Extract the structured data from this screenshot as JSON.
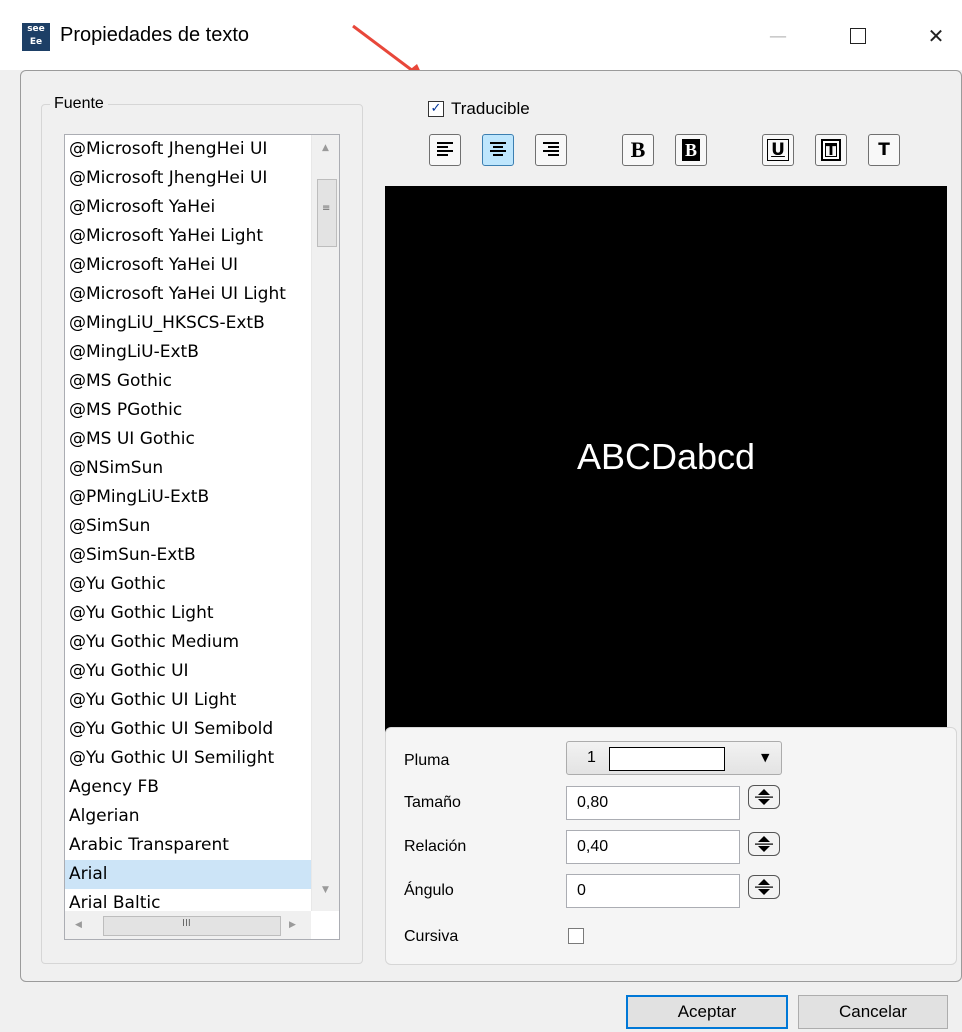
{
  "window": {
    "title": "Propiedades de texto",
    "icon_text": "see Ee",
    "minimize_glyph": "—",
    "maximize_glyph": "☐",
    "close_glyph": "✕"
  },
  "font_group": {
    "label": "Fuente",
    "fonts": [
      "@Microsoft JhengHei UI",
      "@Microsoft JhengHei UI",
      "@Microsoft YaHei",
      "@Microsoft YaHei Light",
      "@Microsoft YaHei UI",
      "@Microsoft YaHei UI Light",
      "@MingLiU_HKSCS-ExtB",
      "@MingLiU-ExtB",
      "@MS Gothic",
      "@MS PGothic",
      "@MS UI Gothic",
      "@NSimSun",
      "@PMingLiU-ExtB",
      "@SimSun",
      "@SimSun-ExtB",
      "@Yu Gothic",
      "@Yu Gothic Light",
      "@Yu Gothic Medium",
      "@Yu Gothic UI",
      "@Yu Gothic UI Light",
      "@Yu Gothic UI Semibold",
      "@Yu Gothic UI Semilight",
      "Agency FB",
      "Algerian",
      "Arabic Transparent",
      "Arial",
      "Arial Baltic"
    ],
    "selected": "Arial"
  },
  "translatable": {
    "label": "Traducible",
    "checked": true
  },
  "toolbar": {
    "align_left": "align-left-icon",
    "align_center": "align-center-icon",
    "align_right": "align-right-icon",
    "bold_label": "B",
    "bold_frame_label": "B",
    "underline_label": "U",
    "frame_label": "T",
    "text_label": "T",
    "active_alignment": "center"
  },
  "preview": {
    "text": "ABCDabcd",
    "background": "#000000",
    "text_color": "#ffffff"
  },
  "properties": {
    "pen_label": "Pluma",
    "pen_value": "1",
    "size_label": "Tamaño",
    "size_value": "0,80",
    "ratio_label": "Relación",
    "ratio_value": "0,40",
    "angle_label": "Ángulo",
    "angle_value": "0",
    "italic_label": "Cursiva",
    "italic_checked": false
  },
  "buttons": {
    "ok": "Aceptar",
    "cancel": "Cancelar"
  },
  "colors": {
    "accent": "#0078d7",
    "selection": "#cce4f7",
    "annotation_arrow": "#e8473a"
  }
}
